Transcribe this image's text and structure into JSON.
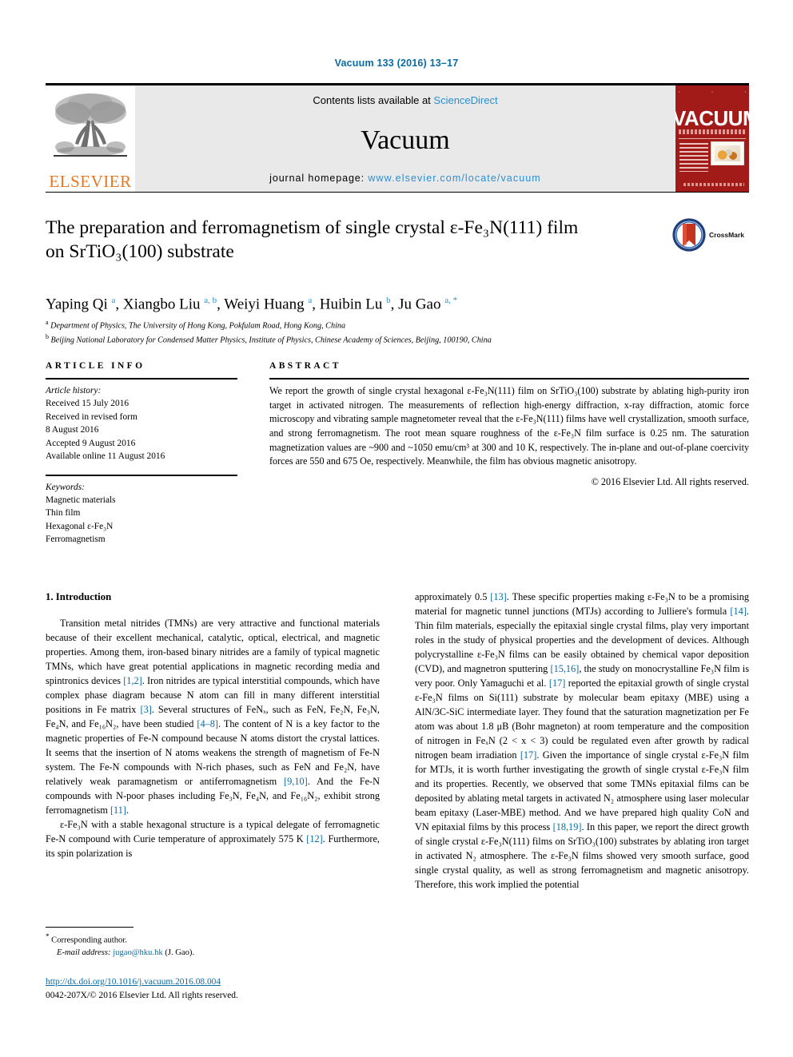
{
  "running_head": "Vacuum 133 (2016) 13–17",
  "banner": {
    "publisher_logo_text": "ELSEVIER",
    "contents_prefix": "Contents lists available at ",
    "contents_link": "ScienceDirect",
    "journal_name": "Vacuum",
    "homepage_prefix": "journal homepage: ",
    "homepage_url": "www.elsevier.com/locate/vacuum",
    "cover_title": "VACUUM",
    "accent_blue": "#2c8fd0",
    "cover_red": "#a21b19",
    "elsevier_orange": "#E87722"
  },
  "article": {
    "title_line1": "The preparation and ferromagnetism of single crystal ε-Fe₃N(111) film",
    "title_line2": "on SrTiO₃(100) substrate",
    "crossmark_label": "CrossMark",
    "authors": "Yaping Qi a, Xiangbo Liu a, b, Weiyi Huang a, Huibin Lu b, Ju Gao a, *",
    "affiliation_a": "Department of Physics, The University of Hong Kong, Pokfulam Road, Hong Kong, China",
    "affiliation_b": "Beijing National Laboratory for Condensed Matter Physics, Institute of Physics, Chinese Academy of Sciences, Beijing, 100190, China"
  },
  "article_info": {
    "heading": "ARTICLE INFO",
    "history_label": "Article history:",
    "history": [
      "Received 15 July 2016",
      "Received in revised form",
      "8 August 2016",
      "Accepted 9 August 2016",
      "Available online 11 August 2016"
    ],
    "keywords_label": "Keywords:",
    "keywords": [
      "Magnetic materials",
      "Thin film",
      "Hexagonal ε-Fe₃N",
      "Ferromagnetism"
    ]
  },
  "abstract": {
    "heading": "ABSTRACT",
    "text": "We report the growth of single crystal hexagonal ε-Fe₃N(111) film on SrTiO₃(100) substrate by ablating high-purity iron target in activated nitrogen. The measurements of reflection high-energy diffraction, x-ray diffraction, atomic force microscopy and vibrating sample magnetometer reveal that the ε-Fe₃N(111) films have well crystallization, smooth surface, and strong ferromagnetism. The root mean square roughness of the ε-Fe₃N film surface is 0.25 nm. The saturation magnetization values are ~900 and ~1050 emu/cm³ at 300 and 10 K, respectively. The in-plane and out-of-plane coercivity forces are 550 and 675 Oe, respectively. Meanwhile, the film has obvious magnetic anisotropy.",
    "copyright": "© 2016 Elsevier Ltd. All rights reserved."
  },
  "introduction": {
    "heading": "1. Introduction",
    "left_paragraph_1": "Transition metal nitrides (TMNs) are very attractive and functional materials because of their excellent mechanical, catalytic, optical, electrical, and magnetic properties. Among them, iron-based binary nitrides are a family of typical magnetic TMNs, which have great potential applications in magnetic recording media and spintronics devices [1,2]. Iron nitrides are typical interstitial compounds, which have complex phase diagram because N atom can fill in many different interstitial positions in Fe matrix [3]. Several structures of FeNₓ, such as FeN, Fe₂N, Fe₃N, Fe₄N, and Fe₁₆N₂, have been studied [4–8]. The content of N is a key factor to the magnetic properties of Fe-N compound because N atoms distort the crystal lattices. It seems that the insertion of N atoms weakens the strength of magnetism of Fe-N system. The Fe-N compounds with N-rich phases, such as FeN and Fe₂N, have relatively weak paramagnetism or antiferromagnetism [9,10]. And the Fe-N compounds with N-poor phases including Fe₃N, Fe₄N, and Fe₁₆N₂, exhibit strong ferromagnetism [11].",
    "left_paragraph_2": "ε-Fe₃N with a stable hexagonal structure is a typical delegate of ferromagnetic Fe-N compound with Curie temperature of approximately 575 K [12]. Furthermore, its spin polarization is",
    "right_paragraph": "approximately 0.5 [13]. These specific properties making ε-Fe₃N to be a promising material for magnetic tunnel junctions (MTJs) according to Julliere's formula [14]. Thin film materials, especially the epitaxial single crystal films, play very important roles in the study of physical properties and the development of devices. Although polycrystalline ε-Fe₃N films can be easily obtained by chemical vapor deposition (CVD), and magnetron sputtering [15,16], the study on monocrystalline Fe₃N film is very poor. Only Yamaguchi et al. [17] reported the epitaxial growth of single crystal ε-Fe₃N films on Si(111) substrate by molecular beam epitaxy (MBE) using a AlN/3C-SiC intermediate layer. They found that the saturation magnetization per Fe atom was about 1.8 μB (Bohr magneton) at room temperature and the composition of nitrogen in FeₓN (2 < x < 3) could be regulated even after growth by radical nitrogen beam irradiation [17]. Given the importance of single crystal ε-Fe₃N film for MTJs, it is worth further investigating the growth of single crystal ε-Fe₃N film and its properties. Recently, we observed that some TMNs epitaxial films can be deposited by ablating metal targets in activated N₂ atmosphere using laser molecular beam epitaxy (Laser-MBE) method. And we have prepared high quality CoN and VN epitaxial films by this process [18,19]. In this paper, we report the direct growth of single crystal ε-Fe₃N(111) films on SrTiO₃(100) substrates by ablating iron target in activated N₂ atmosphere. The ε-Fe₃N films showed very smooth surface, good single crystal quality, as well as strong ferromagnetism and magnetic anisotropy. Therefore, this work implied the potential"
  },
  "footer": {
    "corresponding_author": "Corresponding author.",
    "email_label": "E-mail address:",
    "email": "jugao@hku.hk",
    "email_owner": "(J. Gao).",
    "doi": "http://dx.doi.org/10.1016/j.vacuum.2016.08.004",
    "issn_line": "0042-207X/© 2016 Elsevier Ltd. All rights reserved."
  }
}
